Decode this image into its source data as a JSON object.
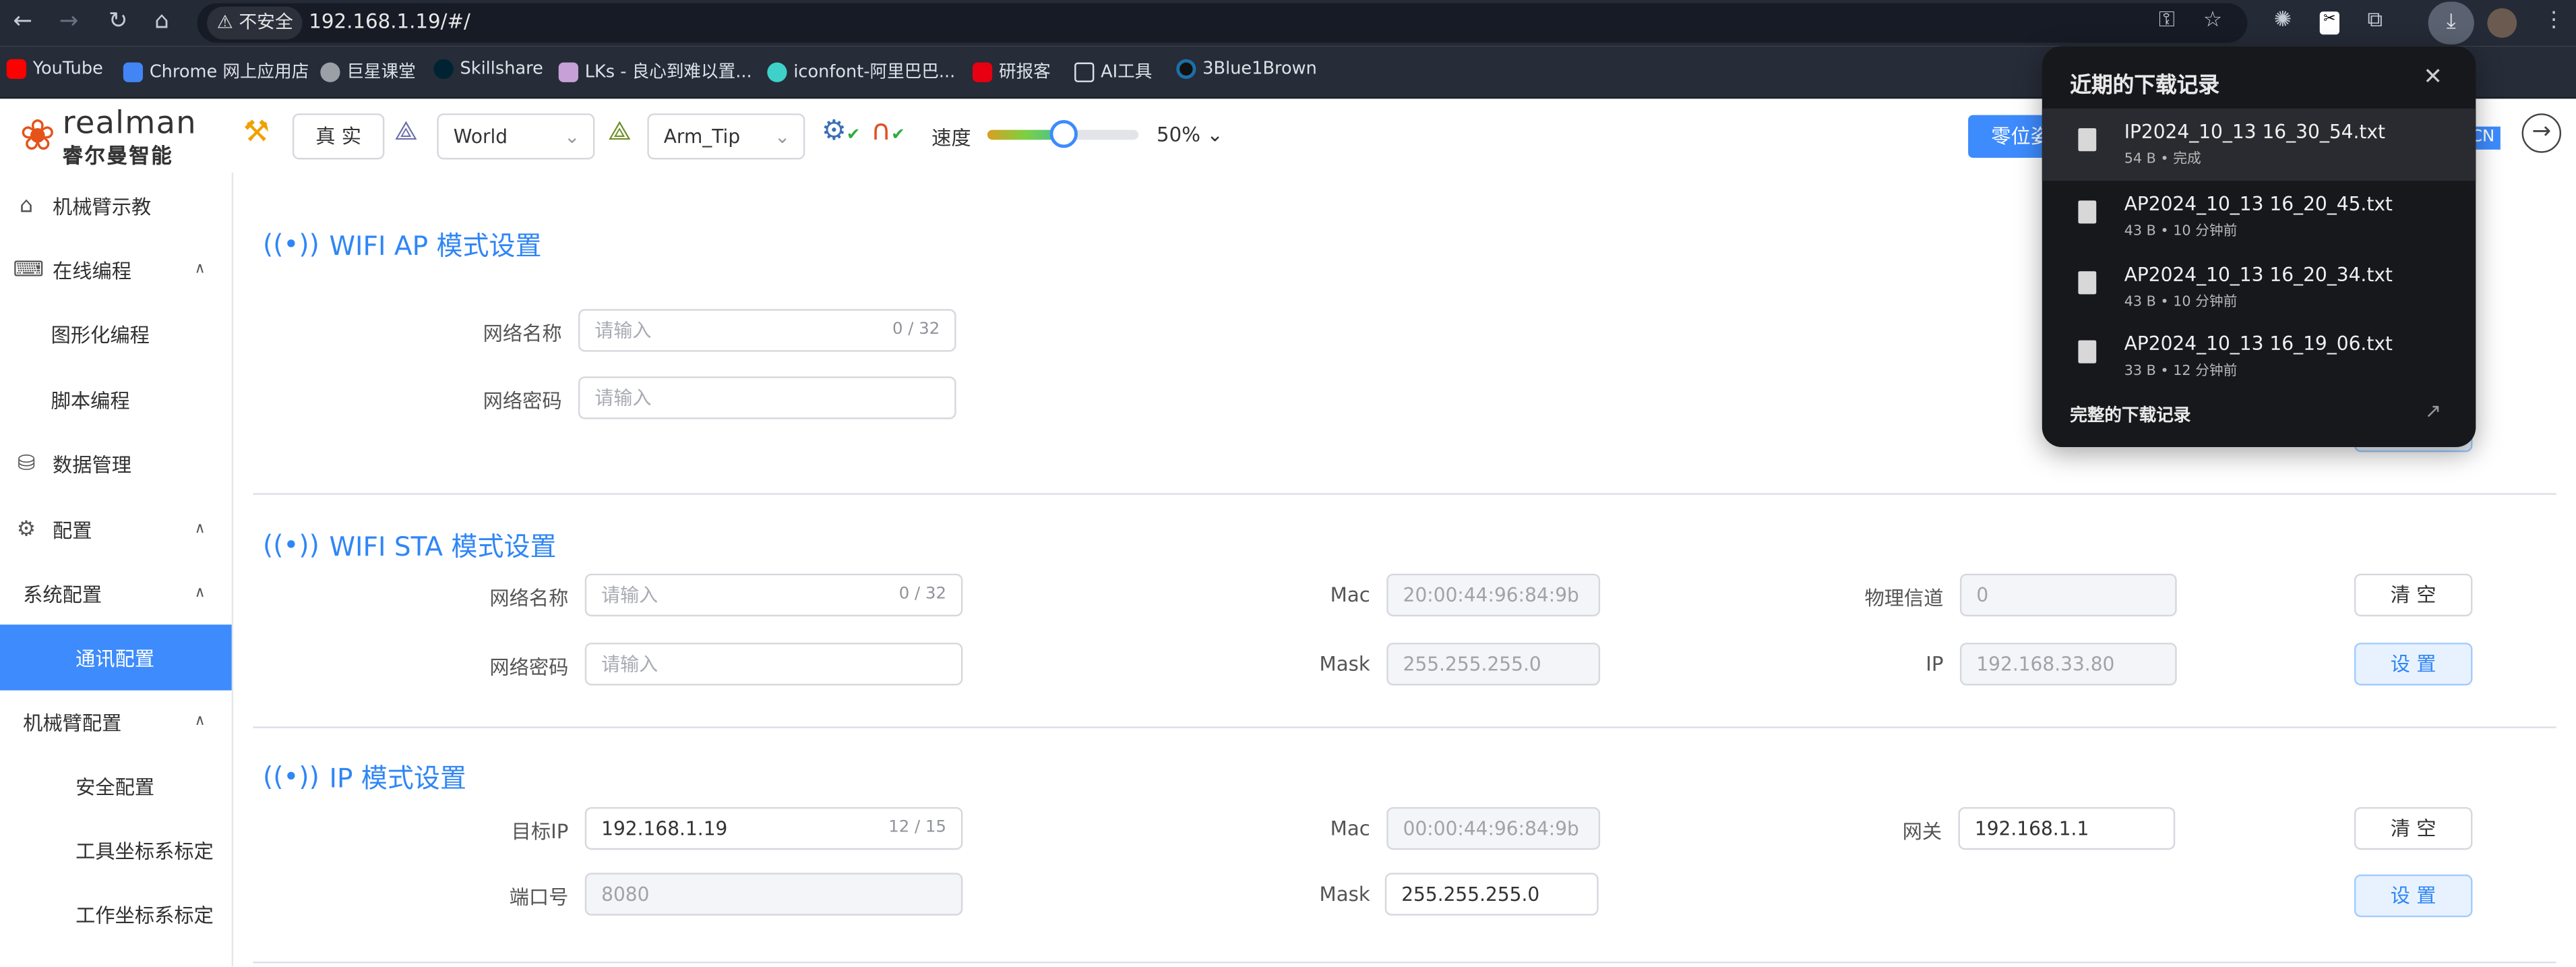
{
  "browser": {
    "insecure_label": "不安全",
    "url": "192.168.1.19/#/",
    "bookmarks": [
      {
        "label": "YouTube",
        "color": "#ff0000"
      },
      {
        "label": "Chrome 网上应用店",
        "color": "#4285f4"
      },
      {
        "label": "巨星课堂",
        "color": "#9aa0a6"
      },
      {
        "label": "Skillshare",
        "color": "#002333"
      },
      {
        "label": "LKs - 良心到难以置...",
        "color": "#c7a0d8"
      },
      {
        "label": "iconfont-阿里巴巴...",
        "color": "#3fd0c9"
      },
      {
        "label": "研报客",
        "color": "#e60012"
      },
      {
        "label": "AI工具",
        "color": "#262c38"
      },
      {
        "label": "3Blue1Brown",
        "color": "#1c6fa8"
      }
    ]
  },
  "header": {
    "logo_text": "realman",
    "logo_sub": "睿尔曼智能",
    "mode_button": "真 实",
    "frame1": "World",
    "frame2": "Arm_Tip",
    "speed_label": "速度",
    "speed_percent": 50,
    "speed_value": "50%",
    "zero_button": "零位姿",
    "lang_badge": "CN"
  },
  "sidebar": {
    "items": [
      {
        "label": "机械臂示教",
        "icon": "home-icon"
      },
      {
        "label": "在线编程",
        "icon": "code-monitor-icon",
        "expanded": true
      },
      {
        "label": "图形化编程"
      },
      {
        "label": "脚本编程"
      },
      {
        "label": "数据管理",
        "icon": "database-icon"
      },
      {
        "label": "配置",
        "icon": "gear-icon",
        "expanded": true
      },
      {
        "label": "系统配置",
        "expanded": true
      },
      {
        "label": "通讯配置",
        "active": true
      },
      {
        "label": "机械臂配置",
        "expanded": true
      },
      {
        "label": "安全配置"
      },
      {
        "label": "工具坐标系标定"
      },
      {
        "label": "工作坐标系标定"
      }
    ]
  },
  "ap": {
    "title": "WIFI AP 模式设置",
    "name_label": "网络名称",
    "name_placeholder": "请输入",
    "name_count": "0 / 32",
    "pwd_label": "网络密码",
    "pwd_placeholder": "请输入"
  },
  "sta": {
    "title": "WIFI STA 模式设置",
    "name_label": "网络名称",
    "name_placeholder": "请输入",
    "name_count": "0 / 32",
    "pwd_label": "网络密码",
    "pwd_placeholder": "请输入",
    "mac_label": "Mac",
    "mac": "20:00:44:96:84:9b",
    "mask_label": "Mask",
    "mask": "255.255.255.0",
    "channel_label": "物理信道",
    "channel": "0",
    "ip_label": "IP",
    "ip": "192.168.33.80",
    "clear": "清 空",
    "set": "设 置"
  },
  "ipmode": {
    "title": "IP 模式设置",
    "target_label": "目标IP",
    "target": "192.168.1.19",
    "target_count": "12 / 15",
    "port_label": "端口号",
    "port_placeholder": "8080",
    "mac_label": "Mac",
    "mac": "00:00:44:96:84:9b",
    "mask_label": "Mask",
    "mask": "255.255.255.0",
    "gw_label": "网关",
    "gw": "192.168.1.1",
    "clear": "清 空",
    "set": "设 置"
  },
  "downloads": {
    "title": "近期的下载记录",
    "footer": "完整的下载记录",
    "items": [
      {
        "name": "IP2024_10_13 16_30_54.txt",
        "meta": "54 B • 完成"
      },
      {
        "name": "AP2024_10_13 16_20_45.txt",
        "meta": "43 B • 10 分钟前"
      },
      {
        "name": "AP2024_10_13 16_20_34.txt",
        "meta": "43 B • 10 分钟前"
      },
      {
        "name": "AP2024_10_13 16_19_06.txt",
        "meta": "33 B • 12 分钟前"
      }
    ]
  },
  "colors": {
    "accent": "#3d8bfd",
    "title": "#2f86f6",
    "popup_bg": "#17181c"
  }
}
